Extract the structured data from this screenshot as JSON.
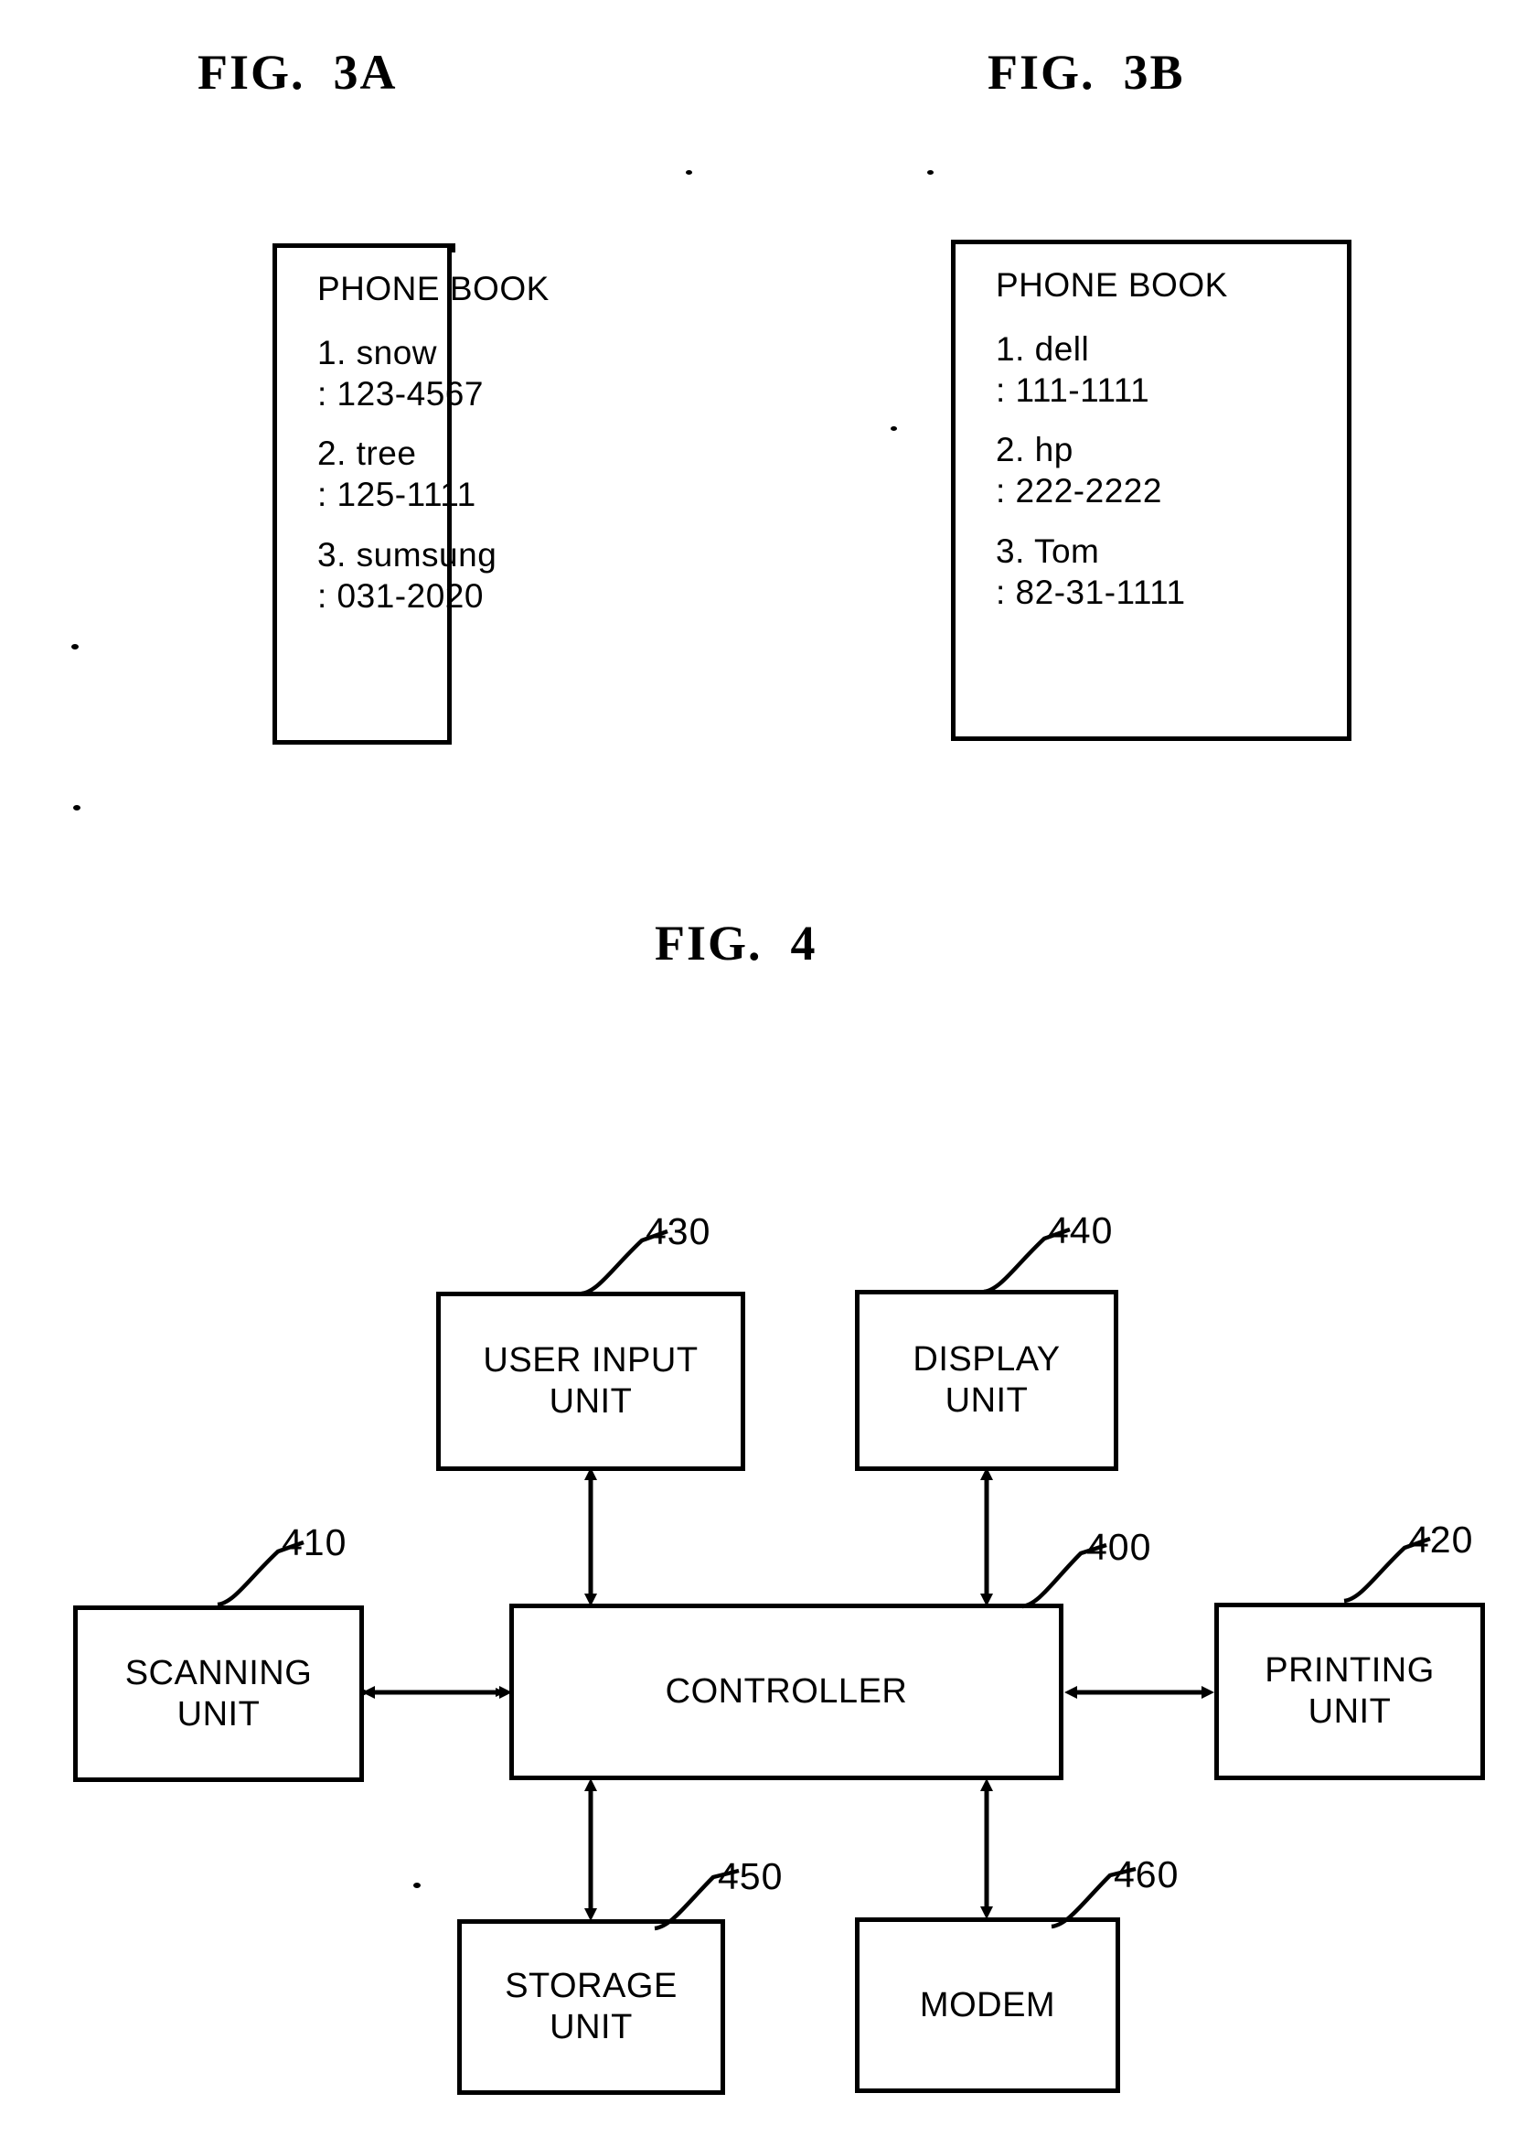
{
  "figures": [
    {
      "id": "fig3a",
      "title": "FIG.  3A"
    },
    {
      "id": "fig3b",
      "title": "FIG.  3B"
    },
    {
      "id": "fig4",
      "title": "FIG.  4"
    }
  ],
  "fig3a": {
    "title": "FIG.  3A",
    "phonebook": {
      "heading": "PHONE BOOK",
      "entries": [
        {
          "name": "1. snow",
          "number": ": 123-4567"
        },
        {
          "name": "2. tree",
          "number": ": 125-1111"
        },
        {
          "name": "3. sumsung",
          "number": ": 031-2020"
        }
      ]
    }
  },
  "fig3b": {
    "title": "FIG.  3B",
    "phonebook": {
      "heading": "PHONE BOOK",
      "entries": [
        {
          "name": "1. dell",
          "number": ": 111-1111"
        },
        {
          "name": "2. hp",
          "number": ": 222-2222"
        },
        {
          "name": "3. Tom",
          "number": ": 82-31-1111"
        }
      ]
    }
  },
  "fig4": {
    "title": "FIG.  4",
    "blocks": [
      {
        "key": "user_input",
        "label": "USER INPUT\nUNIT",
        "ref": "430"
      },
      {
        "key": "display",
        "label": "DISPLAY\nUNIT",
        "ref": "440"
      },
      {
        "key": "scanning",
        "label": "SCANNING\nUNIT",
        "ref": "410"
      },
      {
        "key": "controller",
        "label": "CONTROLLER",
        "ref": "400"
      },
      {
        "key": "printing",
        "label": "PRINTING\nUNIT",
        "ref": "420"
      },
      {
        "key": "storage",
        "label": "STORAGE\nUNIT",
        "ref": "450"
      },
      {
        "key": "modem",
        "label": "MODEM",
        "ref": "460"
      }
    ],
    "connections": [
      {
        "from": "scanning",
        "to": "controller",
        "type": "bidirectional"
      },
      {
        "from": "controller",
        "to": "printing",
        "type": "bidirectional"
      },
      {
        "from": "user_input",
        "to": "controller",
        "type": "bidirectional"
      },
      {
        "from": "display",
        "to": "controller",
        "type": "bidirectional"
      },
      {
        "from": "controller",
        "to": "storage",
        "type": "bidirectional"
      },
      {
        "from": "controller",
        "to": "modem",
        "type": "bidirectional"
      }
    ]
  },
  "colors": {
    "ink": "#000000",
    "paper": "#ffffff"
  }
}
